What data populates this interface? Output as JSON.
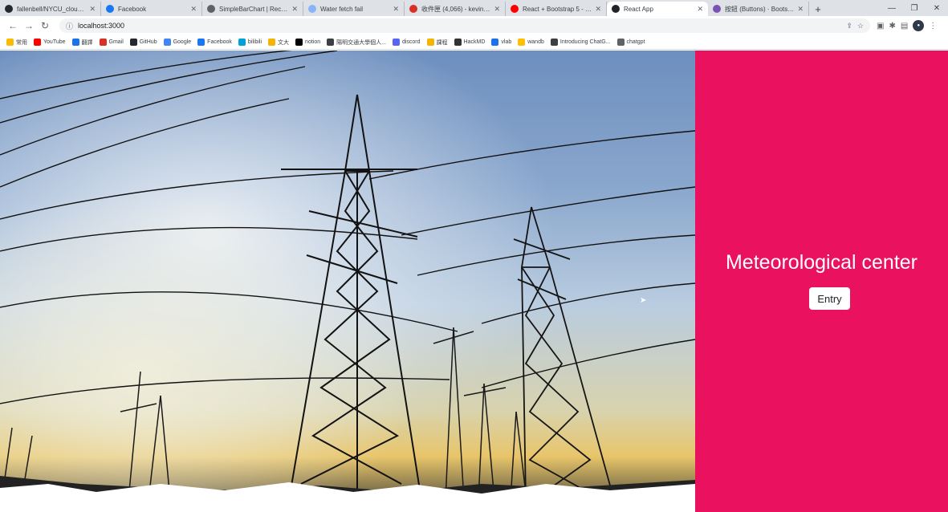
{
  "browser": {
    "tabs": [
      {
        "label": "fallenbell/NYCU_cloud_...",
        "icon": "github-icon",
        "color": "#24292f"
      },
      {
        "label": "Facebook",
        "icon": "facebook-icon",
        "color": "#1877f2"
      },
      {
        "label": "SimpleBarChart | Rechar...",
        "icon": "globe-icon",
        "color": "#5f6368"
      },
      {
        "label": "Water fetch fail",
        "icon": "document-icon",
        "color": "#8ab4f8"
      },
      {
        "label": "收件匣 (4,066) - kevin88...",
        "icon": "gmail-icon",
        "color": "#d93025"
      },
      {
        "label": "React + Bootstrap 5 - Ini...",
        "icon": "youtube-icon",
        "color": "#ff0000"
      },
      {
        "label": "React App",
        "icon": "react-icon",
        "color": "#20232a",
        "active": true
      },
      {
        "label": "按鈕 (Buttons) · Bootstra...",
        "icon": "bootstrap-icon",
        "color": "#7952b3"
      }
    ],
    "new_tab": "+",
    "window_controls": {
      "minimize": "—",
      "restore": "❐",
      "close": "✕"
    },
    "url": "localhost:3000",
    "bookmarks": [
      {
        "label": "常用",
        "color": "#fbbc04"
      },
      {
        "label": "YouTube",
        "color": "#ff0000"
      },
      {
        "label": "翻譯",
        "color": "#1a73e8"
      },
      {
        "label": "Gmail",
        "color": "#d93025"
      },
      {
        "label": "GitHub",
        "color": "#24292f"
      },
      {
        "label": "Google",
        "color": "#4285f4"
      },
      {
        "label": "Facebook",
        "color": "#1877f2"
      },
      {
        "label": "bilibili",
        "color": "#00a1d6"
      },
      {
        "label": "文大",
        "color": "#f4b400"
      },
      {
        "label": "notion",
        "color": "#000000"
      },
      {
        "label": "陽明交通大學個人...",
        "color": "#3c4043"
      },
      {
        "label": "discord",
        "color": "#5865f2"
      },
      {
        "label": "課程",
        "color": "#f4b400"
      },
      {
        "label": "HackMD",
        "color": "#333333"
      },
      {
        "label": "vlab",
        "color": "#1a73e8"
      },
      {
        "label": "wandb",
        "color": "#ffbe00"
      },
      {
        "label": "Introducing ChatG...",
        "color": "#3c4043"
      },
      {
        "label": "chatgpt",
        "color": "#5f6368"
      }
    ]
  },
  "page": {
    "title": "Meteorological center",
    "entry_button": "Entry",
    "panel_color": "#ea125f"
  }
}
